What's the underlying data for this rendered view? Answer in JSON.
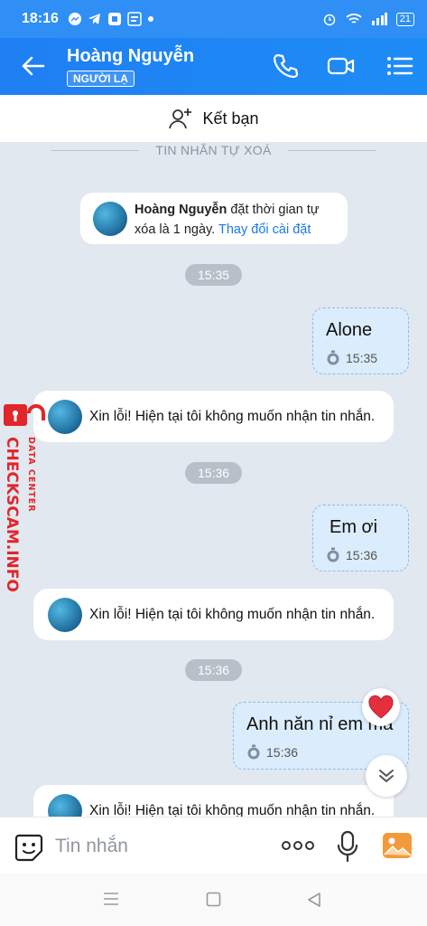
{
  "status_bar": {
    "time": "18:16",
    "battery": "21"
  },
  "header": {
    "contact_name": "Hoàng Nguyễn",
    "badge": "NGƯỜI LẠ"
  },
  "add_friend": {
    "label": "Kết bạn"
  },
  "chat": {
    "divider_label": "TIN NHẮN TỰ XOÁ",
    "system_note": {
      "name": "Hoàng Nguyễn",
      "text": " đặt thời gian tự xóa là 1 ngày. ",
      "link": "Thay đổi cài đặt"
    },
    "messages": [
      {
        "type": "timestamp",
        "text": "15:35"
      },
      {
        "type": "out",
        "text": "Alone",
        "time": "15:35"
      },
      {
        "type": "in",
        "text": "Xin lỗi! Hiện tại tôi không muốn nhận tin nhắn."
      },
      {
        "type": "timestamp",
        "text": "15:36"
      },
      {
        "type": "out",
        "text": "Em ơi",
        "time": "15:36"
      },
      {
        "type": "in",
        "text": "Xin lỗi! Hiện tại tôi không muốn nhận tin nhắn."
      },
      {
        "type": "timestamp",
        "text": "15:36"
      },
      {
        "type": "out",
        "text": "Anh năn nỉ em mà",
        "time": "15:36"
      },
      {
        "type": "in",
        "text": "Xin lỗi! Hiện tại tôi không muốn nhận tin nhắn."
      }
    ]
  },
  "watermark": {
    "top": "DATA CENTER",
    "main": "CHECKSCAM.INFO",
    "color": "#e0262b"
  },
  "composer": {
    "placeholder": "Tin nhắn"
  },
  "colors": {
    "header": "#1f7ff3",
    "link": "#1a79e6",
    "out_bubble": "#dbecfc"
  },
  "icons": [
    "back-arrow-icon",
    "phone-icon",
    "video-call-icon",
    "menu-icon",
    "add-friend-icon",
    "timer-icon",
    "heart-icon",
    "chevron-double-down-icon",
    "sticker-icon",
    "more-icon",
    "microphone-icon",
    "image-icon"
  ]
}
